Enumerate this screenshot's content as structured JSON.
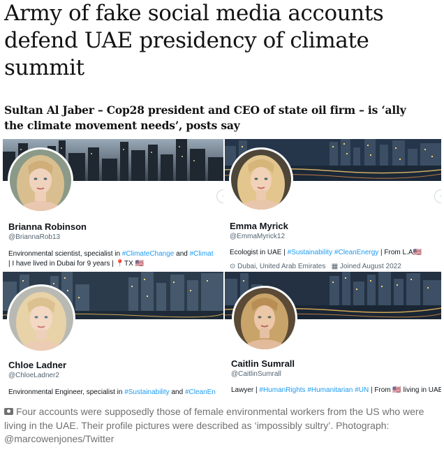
{
  "article": {
    "headline": "Army of fake social media accounts defend UAE presidency of climate summit",
    "standfirst": "Sultan Al Jaber – Cop28 president and CEO of state oil firm – is ‘ally the climate movement needs’, posts say",
    "caption": "Four accounts were supposedly those of female environmental workers from the US who were living in the UAE. Their profile pictures were described as ‘impossibly sultry’. Photograph: @marcowenjones/Twitter"
  },
  "profiles": [
    {
      "name": "Brianna Robinson",
      "handle": "@BriannaRob13",
      "bio_line1_parts": [
        "Environmental scientist, specialist in ",
        "#ClimateChange",
        " and ",
        "#Climat"
      ],
      "bio_line2": "| I have lived in Dubai for 9 years | 📍TX 🇺🇸",
      "hair_color": "#d9bf8f"
    },
    {
      "name": "Emma Myrick",
      "handle": "@EmmaMyrick12",
      "bio_line1_parts": [
        "Ecologist in UAE | ",
        "#Sustainability",
        " ",
        "#CleanEnergy",
        " | From L.A🇺🇸"
      ],
      "location": "Dubai, United Arab Emirates",
      "joined": "Joined August 2022",
      "hair_color": "#e3c68e"
    },
    {
      "name": "Chloe Ladner",
      "handle": "@ChloeLadner2",
      "bio_line1_parts": [
        "Environmental Engineer, specialist in ",
        "#Sustainability",
        " and ",
        "#CleanEn"
      ],
      "hair_color": "#e8d2a8"
    },
    {
      "name": "Caitlin Sumrall",
      "handle": "@CaitlinSumrall",
      "bio_line1_parts": [
        "Lawyer | ",
        "#HumanRights",
        " ",
        "#Humanitarian",
        " ",
        "#UN",
        " | From 🇺🇸 living in UAE"
      ],
      "hair_color": "#c9a46a"
    }
  ],
  "icons": {
    "more": "more-options-icon",
    "camera": "camera-icon",
    "location": "location-pin-icon",
    "calendar": "calendar-icon"
  },
  "colors": {
    "link": "#1d9bf0",
    "caption": "#707070",
    "handle": "#536471"
  }
}
